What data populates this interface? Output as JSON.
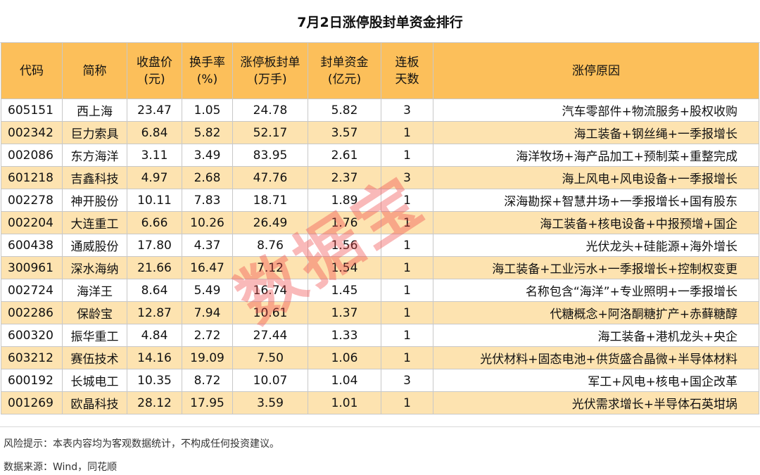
{
  "title": "7月2日涨停股封单资金排行",
  "headers": [
    [
      "代码"
    ],
    [
      "简称"
    ],
    [
      "收盘价",
      "(元)"
    ],
    [
      "换手率",
      "(%)"
    ],
    [
      "涨停板封单",
      "(万手)"
    ],
    [
      "封单资金",
      "(亿元)"
    ],
    [
      "连板",
      "天数"
    ],
    [
      "涨停原因"
    ]
  ],
  "rows": [
    [
      "605151",
      "西上海",
      "23.47",
      "1.05",
      "24.78",
      "5.82",
      "3",
      "汽车零部件+物流服务+股权收购"
    ],
    [
      "002342",
      "巨力索具",
      "6.84",
      "5.82",
      "52.17",
      "3.57",
      "1",
      "海工装备+钢丝绳+一季报增长"
    ],
    [
      "002086",
      "东方海洋",
      "3.11",
      "3.49",
      "83.95",
      "2.61",
      "1",
      "海洋牧场+海产品加工+预制菜+重整完成"
    ],
    [
      "601218",
      "吉鑫科技",
      "4.97",
      "2.68",
      "47.76",
      "2.37",
      "3",
      "海上风电+风电设备+一季报增长"
    ],
    [
      "002278",
      "神开股份",
      "10.11",
      "7.83",
      "18.71",
      "1.89",
      "1",
      "深海勘探+智慧井场+一季报增长+国有股东"
    ],
    [
      "002204",
      "大连重工",
      "6.66",
      "10.26",
      "26.49",
      "1.76",
      "1",
      "海工装备+核电设备+中报预增+国企"
    ],
    [
      "600438",
      "通威股份",
      "17.80",
      "4.37",
      "8.76",
      "1.56",
      "1",
      "光伏龙头+硅能源+海外增长"
    ],
    [
      "300961",
      "深水海纳",
      "21.66",
      "16.47",
      "7.12",
      "1.54",
      "1",
      "海工装备+工业污水+一季报增长+控制权变更"
    ],
    [
      "002724",
      "海洋王",
      "8.64",
      "5.49",
      "16.74",
      "1.45",
      "1",
      "名称包含“海洋”+专业照明+一季报增长"
    ],
    [
      "002286",
      "保龄宝",
      "12.87",
      "7.94",
      "10.61",
      "1.37",
      "1",
      "代糖概念+阿洛酮糖扩产+赤藓糖醇"
    ],
    [
      "600320",
      "振华重工",
      "4.84",
      "2.72",
      "27.44",
      "1.33",
      "1",
      "海工装备+港机龙头+央企"
    ],
    [
      "603212",
      "赛伍技术",
      "14.16",
      "19.09",
      "7.50",
      "1.06",
      "1",
      "光伏材料+固态电池+供货盛合晶微+半导体材料"
    ],
    [
      "600192",
      "长城电工",
      "10.35",
      "8.72",
      "10.07",
      "1.04",
      "3",
      "军工+风电+核电+国企改革"
    ],
    [
      "001269",
      "欧晶科技",
      "28.12",
      "17.95",
      "3.59",
      "1.01",
      "1",
      "光伏需求增长+半导体石英坩埚"
    ]
  ],
  "footer": {
    "risk_note": "风险提示：本表内容均为客观数据统计，不构成任何投资建议。",
    "source": "数据来源：Wind，同花顺"
  },
  "watermark": "数据宝",
  "colors": {
    "header_bg": "#fcbf5a",
    "stripe_bg": "#fde3b0",
    "watermark": "#ee4646"
  }
}
